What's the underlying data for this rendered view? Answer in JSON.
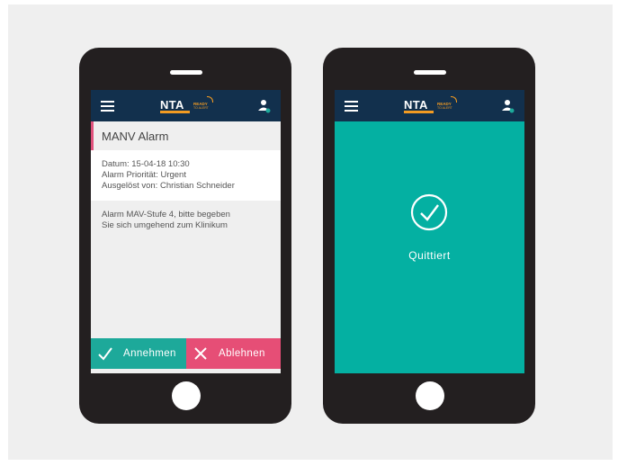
{
  "app": {
    "logo_text": "NTA",
    "logo_tagline": "READY",
    "logo_sub": "TO ALERT"
  },
  "alarm_screen": {
    "title": "MANV Alarm",
    "details": {
      "datum": "Datum: 15-04-18  10:30",
      "prioritaet": "Alarm Priorität: Urgent",
      "ausgeloest": "Ausgelöst von: Christian Schneider"
    },
    "message": "Alarm MAV-Stufe 4, bitte begeben\nSie sich umgehend zum Klinikum",
    "accept_label": "Annehmen",
    "reject_label": "Ablehnen"
  },
  "confirmed_screen": {
    "status_label": "Quittiert"
  },
  "colors": {
    "navbar": "#12304d",
    "accent_green": "#1da99a",
    "accent_red": "#e64e76",
    "confirmed_bg": "#04b0a2",
    "logo_orange": "#f29b22"
  },
  "icons": [
    "menu-icon",
    "user-icon",
    "check-icon",
    "close-icon",
    "check-circle-icon"
  ]
}
